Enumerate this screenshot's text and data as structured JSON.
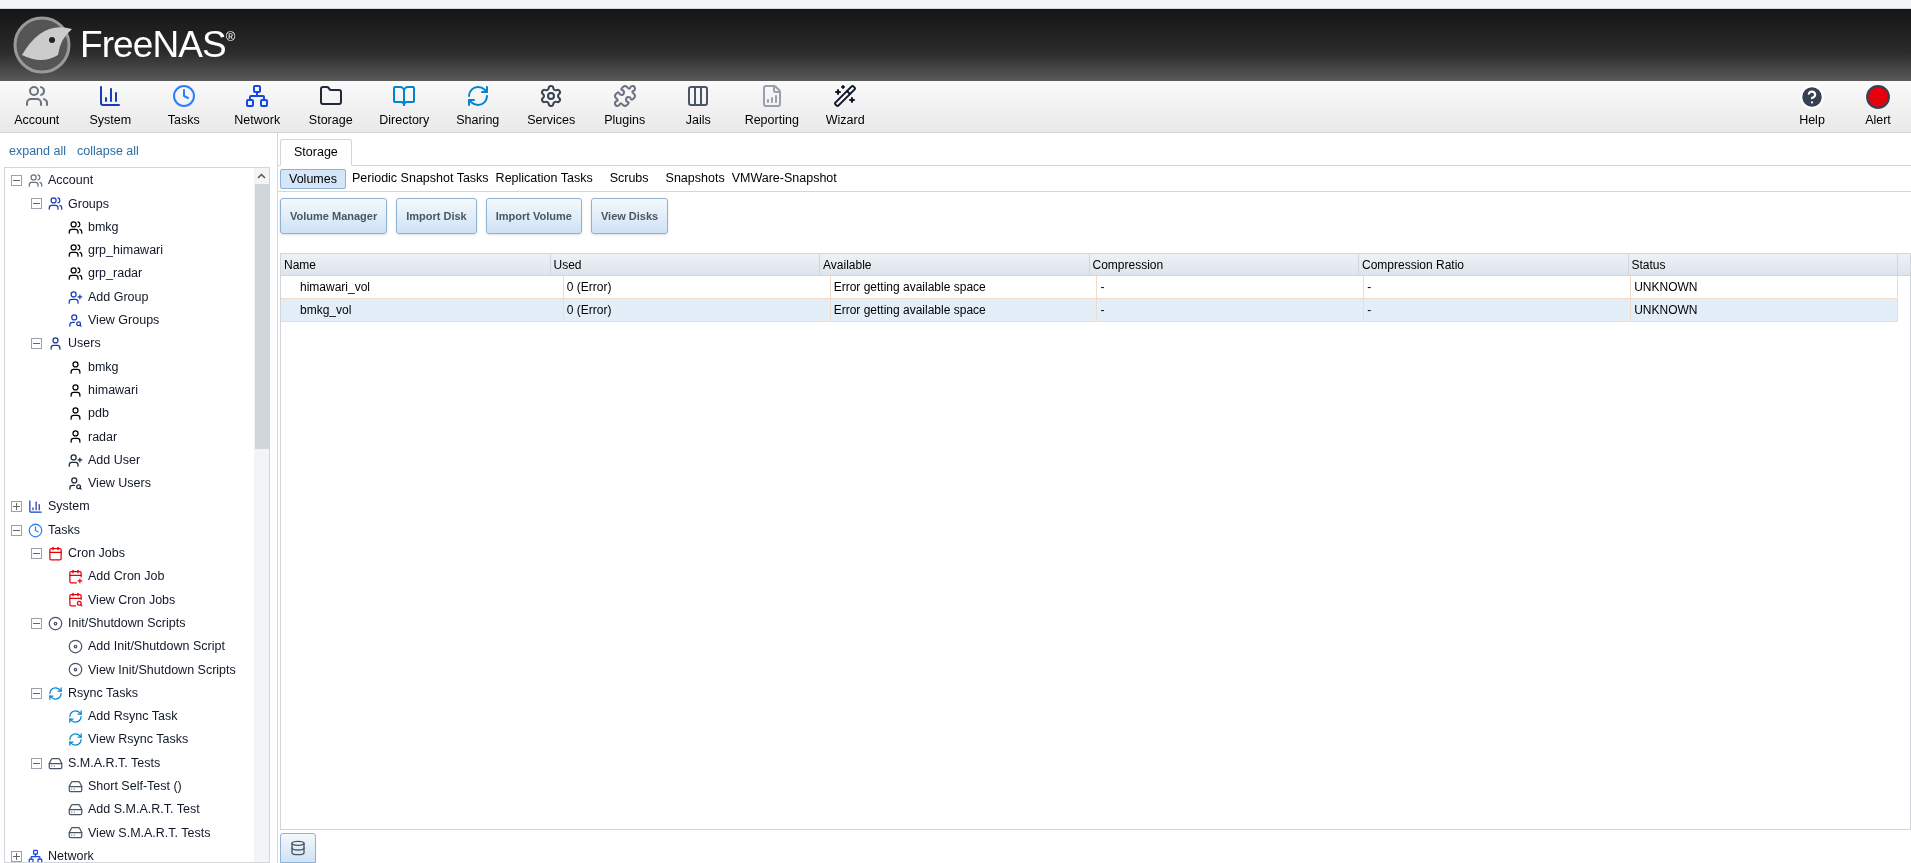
{
  "brand": {
    "name": "FreeNAS",
    "mark": "®"
  },
  "toolbar": [
    {
      "label": "Account",
      "kind": "account"
    },
    {
      "label": "System",
      "kind": "system"
    },
    {
      "label": "Tasks",
      "kind": "tasks"
    },
    {
      "label": "Network",
      "kind": "network"
    },
    {
      "label": "Storage",
      "kind": "storage"
    },
    {
      "label": "Directory",
      "kind": "directory"
    },
    {
      "label": "Sharing",
      "kind": "sharing"
    },
    {
      "label": "Services",
      "kind": "services"
    },
    {
      "label": "Plugins",
      "kind": "plugins"
    },
    {
      "label": "Jails",
      "kind": "jails"
    },
    {
      "label": "Reporting",
      "kind": "reporting"
    },
    {
      "label": "Wizard",
      "kind": "wizard"
    }
  ],
  "toolbar_right": [
    {
      "label": "Help",
      "kind": "help"
    },
    {
      "label": "Alert",
      "kind": "alert"
    }
  ],
  "sidebar": {
    "links": [
      "expand all",
      "collapse all"
    ],
    "tree": [
      {
        "label": "Account",
        "kind": "account",
        "expanded": true,
        "children": [
          {
            "label": "Groups",
            "kind": "groups",
            "expanded": true,
            "children": [
              {
                "label": "bmkg",
                "kind": "group"
              },
              {
                "label": "grp_himawari",
                "kind": "group"
              },
              {
                "label": "grp_radar",
                "kind": "group"
              },
              {
                "label": "Add Group",
                "kind": "add-group"
              },
              {
                "label": "View Groups",
                "kind": "view-groups"
              }
            ]
          },
          {
            "label": "Users",
            "kind": "users",
            "expanded": true,
            "children": [
              {
                "label": "bmkg",
                "kind": "user"
              },
              {
                "label": "himawari",
                "kind": "user"
              },
              {
                "label": "pdb",
                "kind": "user"
              },
              {
                "label": "radar",
                "kind": "user"
              },
              {
                "label": "Add User",
                "kind": "add-user"
              },
              {
                "label": "View Users",
                "kind": "view-users"
              }
            ]
          }
        ]
      },
      {
        "label": "System",
        "kind": "system",
        "expanded": false
      },
      {
        "label": "Tasks",
        "kind": "tasks",
        "expanded": true,
        "children": [
          {
            "label": "Cron Jobs",
            "kind": "cron",
            "expanded": true,
            "children": [
              {
                "label": "Add Cron Job",
                "kind": "add-cron"
              },
              {
                "label": "View Cron Jobs",
                "kind": "view-cron"
              }
            ]
          },
          {
            "label": "Init/Shutdown Scripts",
            "kind": "script",
            "expanded": true,
            "children": [
              {
                "label": "Add Init/Shutdown Script",
                "kind": "add-script"
              },
              {
                "label": "View Init/Shutdown Scripts",
                "kind": "view-script"
              }
            ]
          },
          {
            "label": "Rsync Tasks",
            "kind": "rsync",
            "expanded": true,
            "children": [
              {
                "label": "Add Rsync Task",
                "kind": "add-rsync"
              },
              {
                "label": "View Rsync Tasks",
                "kind": "view-rsync"
              }
            ]
          },
          {
            "label": "S.M.A.R.T. Tests",
            "kind": "smart",
            "expanded": true,
            "children": [
              {
                "label": "Short Self-Test ()",
                "kind": "smart"
              },
              {
                "label": "Add S.M.A.R.T. Test",
                "kind": "add-smart"
              },
              {
                "label": "View S.M.A.R.T. Tests",
                "kind": "view-smart"
              }
            ]
          }
        ]
      },
      {
        "label": "Network",
        "kind": "network",
        "expanded": false
      }
    ]
  },
  "tabs": [
    {
      "label": "Storage",
      "selected": true
    }
  ],
  "subtabs": [
    {
      "label": "Volumes",
      "selected": true
    },
    {
      "label": "Periodic Snapshot Tasks",
      "selected": false
    },
    {
      "label": "Replication Tasks",
      "selected": false
    },
    {
      "label": "Scrubs",
      "selected": false
    },
    {
      "label": "Snapshots",
      "selected": false
    },
    {
      "label": "VMWare-Snapshot",
      "selected": false
    }
  ],
  "buttons": [
    "Volume Manager",
    "Import Disk",
    "Import Volume",
    "View Disks"
  ],
  "table": {
    "columns": [
      "Name",
      "Used",
      "Available",
      "Compression",
      "Compression Ratio",
      "Status"
    ],
    "rows": [
      {
        "selected": false,
        "cells": [
          "himawari_vol",
          "0 (Error)",
          "Error getting available space",
          "-",
          "-",
          "UNKNOWN"
        ]
      },
      {
        "selected": true,
        "cells": [
          "bmkg_vol",
          "0 (Error)",
          "Error getting available space",
          "-",
          "-",
          "UNKNOWN"
        ]
      }
    ]
  }
}
